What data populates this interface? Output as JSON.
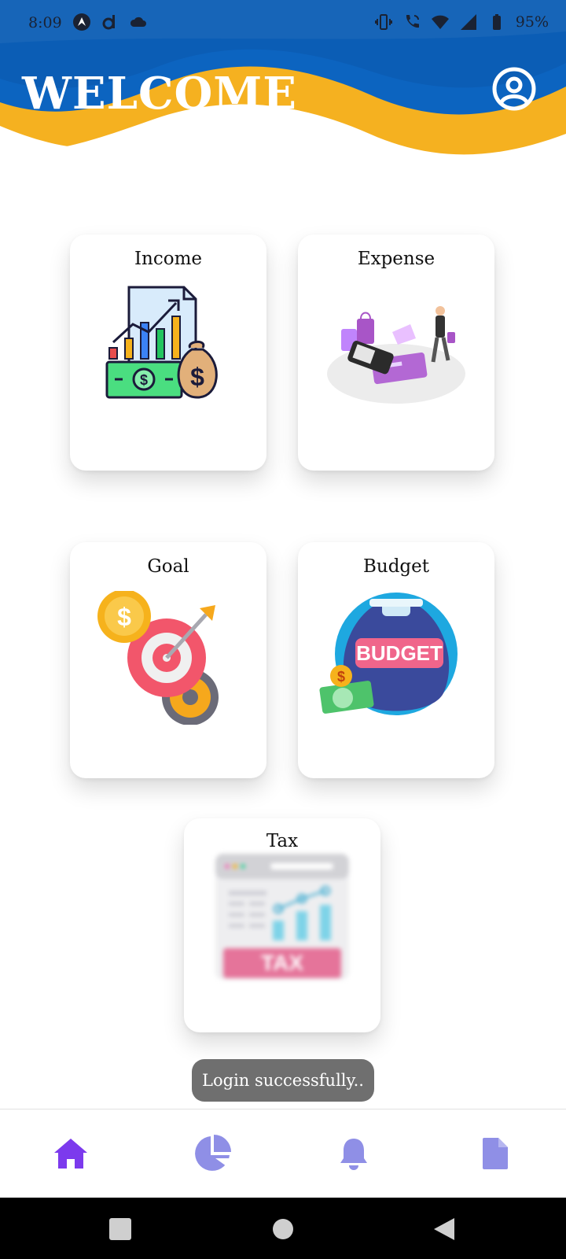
{
  "status_bar": {
    "time": "8:09",
    "battery": "95%",
    "left_icons": [
      "android-auto-icon",
      "d-app-icon",
      "cloud-icon"
    ],
    "right_icons": [
      "vibrate-icon",
      "wifi-call-icon",
      "wifi-icon",
      "signal-icon",
      "battery-icon"
    ]
  },
  "header": {
    "title": "WELCOME",
    "profile_icon": "user-circle-icon",
    "colors": {
      "blue": "#0a5db8",
      "yellow": "#f6b21c"
    }
  },
  "cards": {
    "income": {
      "label": "Income",
      "icon": "income-chart-money-icon"
    },
    "expense": {
      "label": "Expense",
      "icon": "shopping-card-icon"
    },
    "goal": {
      "label": "Goal",
      "icon": "target-goal-icon"
    },
    "budget": {
      "label": "Budget",
      "icon": "budget-bag-icon",
      "badge_text": "BUDGET"
    },
    "tax": {
      "label": "Tax",
      "icon": "tax-report-icon",
      "badge_text": "TAX"
    }
  },
  "toast": {
    "message": "Login successfully.."
  },
  "bottom_nav": {
    "items": [
      {
        "icon": "home-icon",
        "active": true
      },
      {
        "icon": "pie-chart-icon",
        "active": false
      },
      {
        "icon": "bell-icon",
        "active": false
      },
      {
        "icon": "document-icon",
        "active": false
      }
    ],
    "colors": {
      "active": "#7c3aed",
      "inactive": "#8f8fe6"
    }
  },
  "system_nav": {
    "icons": [
      "recent-apps-icon",
      "home-circle-icon",
      "back-icon"
    ]
  }
}
